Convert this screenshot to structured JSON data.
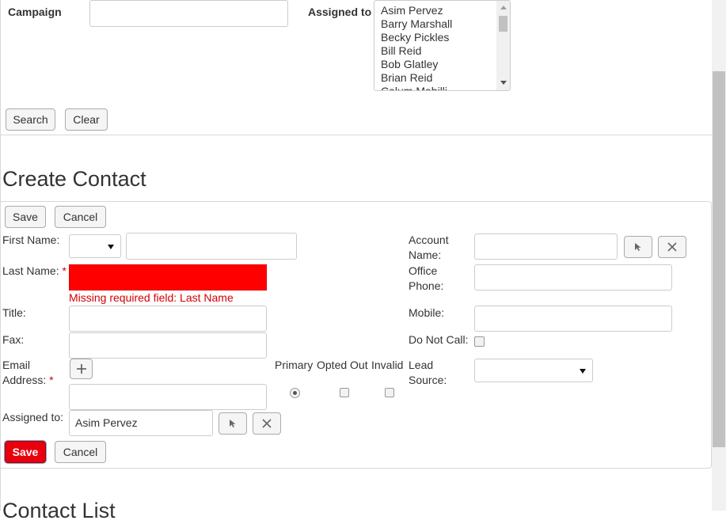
{
  "search_panel": {
    "campaign_label": "Campaign",
    "campaign_value": "",
    "assigned_to_label": "Assigned to",
    "assigned_to_options": [
      "Asim Pervez",
      "Barry Marshall",
      "Becky Pickles",
      "Bill Reid",
      "Bob Glatley",
      "Brian Reid",
      "Calum Mabilli"
    ],
    "search_button": "Search",
    "clear_button": "Clear"
  },
  "create_contact": {
    "heading": "Create Contact",
    "save_button": "Save",
    "cancel_button": "Cancel",
    "first_name_label": "First Name:",
    "salutation_value": "",
    "first_name_value": "",
    "last_name_label": "Last Name:",
    "required_marker": "*",
    "last_name_value": "",
    "last_name_error": "Missing required field: Last Name",
    "title_label": "Title:",
    "fax_label": "Fax:",
    "email_label_line1": "Email",
    "email_label_line2": "Address:",
    "email_col_primary": "Primary",
    "email_col_opted_out": "Opted Out",
    "email_col_invalid": "Invalid",
    "assigned_to_label": "Assigned to:",
    "assigned_to_value": "Asim Pervez",
    "account_name_label_line1": "Account",
    "account_name_label_line2": "Name:",
    "office_phone_label_line1": "Office",
    "office_phone_label_line2": "Phone:",
    "mobile_label": "Mobile:",
    "do_not_call_label": "Do Not Call:",
    "lead_source_label_line1": "Lead",
    "lead_source_label_line2": "Source:",
    "lead_source_value": "",
    "save_button_bottom": "Save",
    "cancel_button_bottom": "Cancel"
  },
  "contact_list": {
    "heading": "Contact List"
  },
  "colors": {
    "error_fill": "#ff0000",
    "error_text": "#d40000",
    "primary_save": "#e8000c"
  }
}
